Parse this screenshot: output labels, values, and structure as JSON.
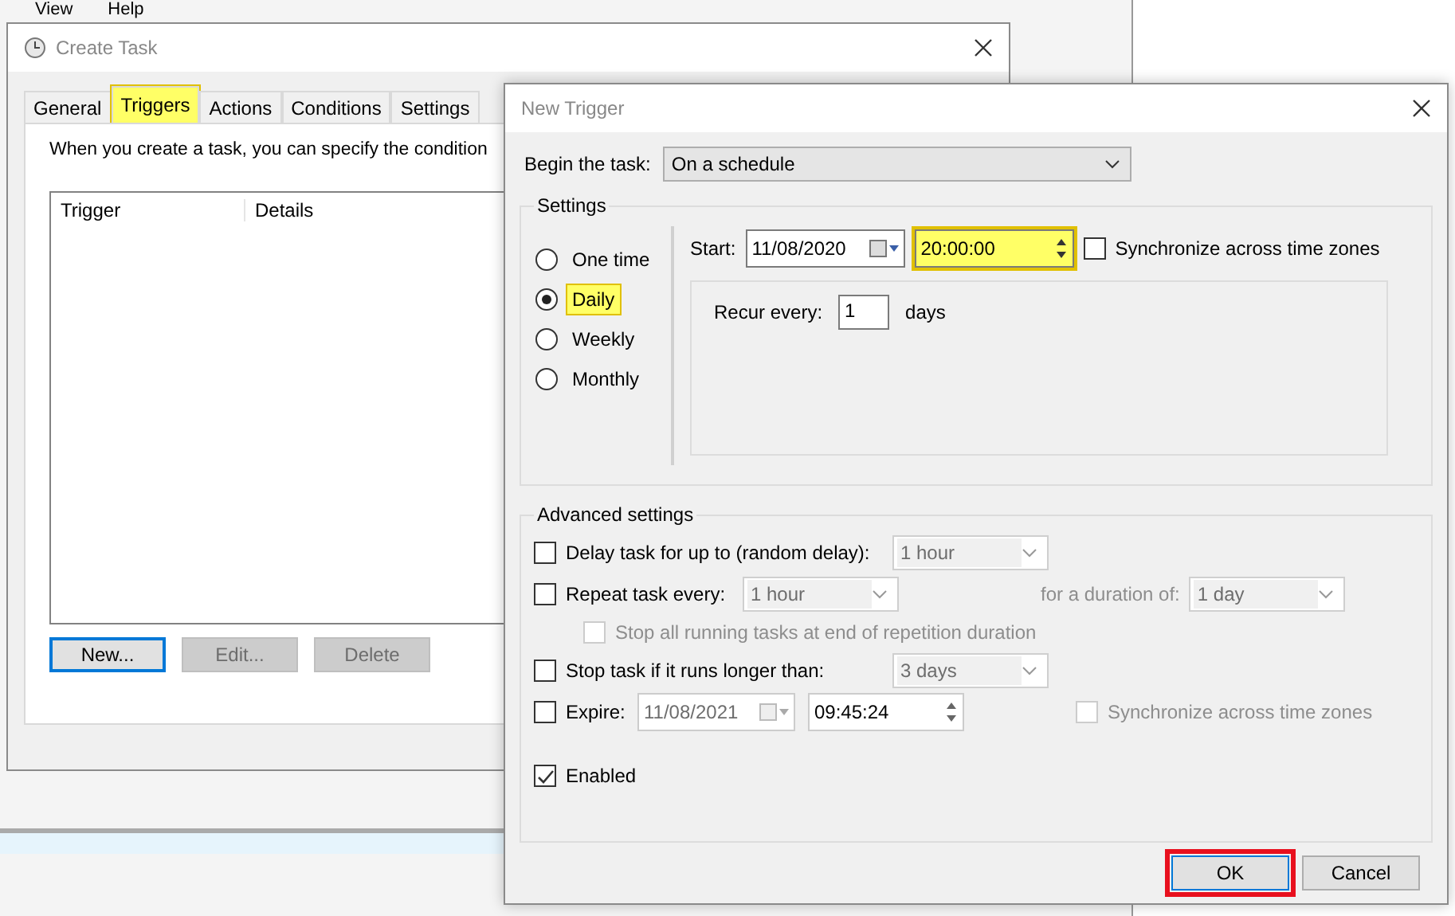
{
  "background_app": {
    "menu": [
      "View",
      "Help"
    ]
  },
  "create_task": {
    "title": "Create Task",
    "tabs": [
      {
        "label": "General",
        "selected": false,
        "highlighted": false
      },
      {
        "label": "Triggers",
        "selected": true,
        "highlighted": true
      },
      {
        "label": "Actions",
        "selected": false,
        "highlighted": false
      },
      {
        "label": "Conditions",
        "selected": false,
        "highlighted": false
      },
      {
        "label": "Settings",
        "selected": false,
        "highlighted": false
      }
    ],
    "intro": "When you create a task, you can specify the condition",
    "table": {
      "columns": [
        "Trigger",
        "Details"
      ]
    },
    "buttons": [
      {
        "label": "New...",
        "disabled": false,
        "focused": true
      },
      {
        "label": "Edit...",
        "disabled": true,
        "focused": false
      },
      {
        "label": "Delete",
        "disabled": true,
        "focused": false
      }
    ]
  },
  "new_trigger": {
    "title": "New Trigger",
    "begin_label": "Begin the task:",
    "begin_value": "On a schedule",
    "settings": {
      "legend": "Settings",
      "schedules": [
        {
          "label": "One time",
          "selected": false,
          "highlighted": false
        },
        {
          "label": "Daily",
          "selected": true,
          "highlighted": true
        },
        {
          "label": "Weekly",
          "selected": false,
          "highlighted": false
        },
        {
          "label": "Monthly",
          "selected": false,
          "highlighted": false
        }
      ],
      "start_label": "Start:",
      "start_date": "11/08/2020",
      "start_time": "20:00:00",
      "time_highlighted": true,
      "sync": {
        "label": "Synchronize across time zones",
        "checked": false,
        "disabled": false
      },
      "recur_label": "Recur every:",
      "recur_value": "1",
      "recur_unit": "days"
    },
    "advanced": {
      "legend": "Advanced settings",
      "delay": {
        "label": "Delay task for up to (random delay):",
        "checked": false,
        "value": "1 hour"
      },
      "repeat": {
        "label": "Repeat task every:",
        "checked": false,
        "value": "1 hour",
        "duration_label": "for a duration of:",
        "duration_value": "1 day"
      },
      "stop_all": {
        "label": "Stop all running tasks at end of repetition duration",
        "checked": false,
        "disabled": true
      },
      "stop": {
        "label": "Stop task if it runs longer than:",
        "checked": false,
        "value": "3 days"
      },
      "expire": {
        "label": "Expire:",
        "checked": false,
        "date": "11/08/2021",
        "time": "09:45:24"
      },
      "expire_sync": {
        "label": "Synchronize across time zones",
        "checked": false,
        "disabled": true
      },
      "enabled": {
        "label": "Enabled",
        "checked": true,
        "disabled": false
      }
    },
    "buttons": [
      {
        "label": "OK",
        "highlighted": true
      },
      {
        "label": "Cancel",
        "highlighted": false
      }
    ]
  }
}
